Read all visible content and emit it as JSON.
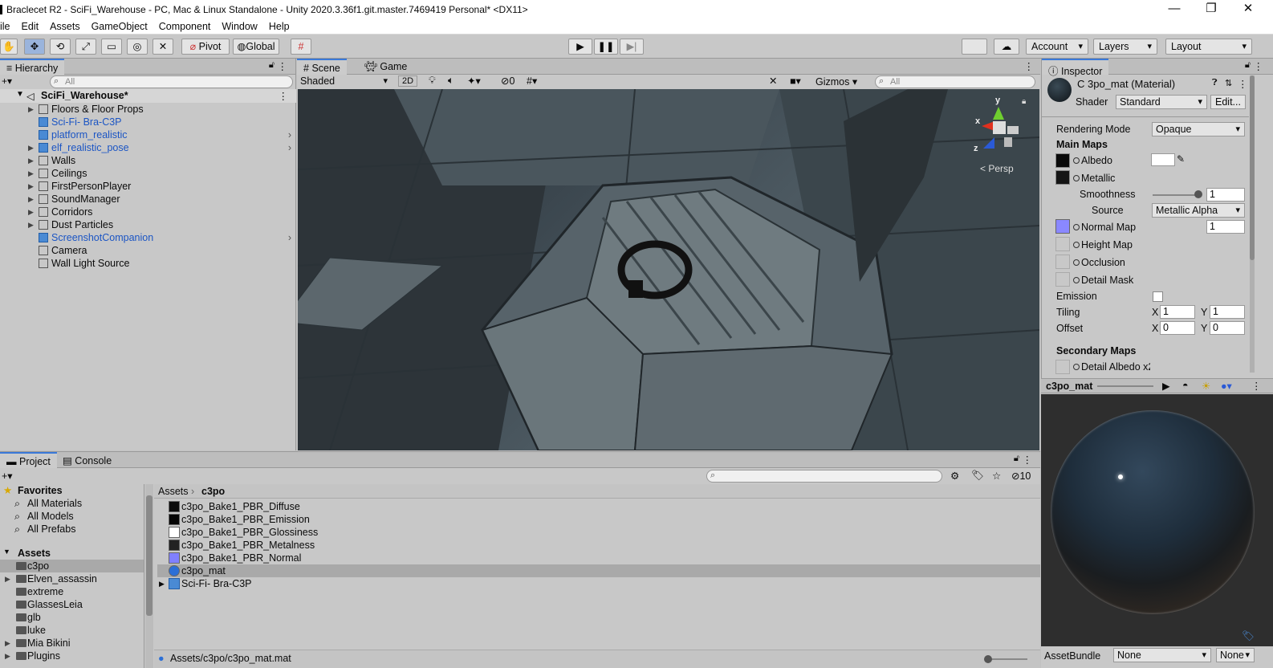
{
  "window": {
    "title": "Braclecet R2 - SciFi_Warehouse - PC, Mac & Linux Standalone - Unity 2020.3.36f1.git.master.7469419 Personal* <DX11>"
  },
  "menu": [
    "ile",
    "Edit",
    "Assets",
    "GameObject",
    "Component",
    "Window",
    "Help"
  ],
  "toolbar": {
    "pivot": "Pivot",
    "global": "Global",
    "account": "Account",
    "layers": "Layers",
    "layout": "Layout"
  },
  "hierarchy": {
    "tab": "Hierarchy",
    "search_placeholder": "All",
    "scene_name": "SciFi_Warehouse*",
    "items": [
      {
        "label": "Floors & Floor Props",
        "prefab": false,
        "expand": true
      },
      {
        "label": "Sci-Fi- Bra-C3P",
        "prefab": true,
        "expand": false
      },
      {
        "label": "platform_realistic",
        "prefab": true,
        "expand": false
      },
      {
        "label": "elf_realistic_pose",
        "prefab": true,
        "expand": true
      },
      {
        "label": "Walls",
        "prefab": false,
        "expand": true
      },
      {
        "label": "Ceilings",
        "prefab": false,
        "expand": true
      },
      {
        "label": "FirstPersonPlayer",
        "prefab": false,
        "expand": true
      },
      {
        "label": "SoundManager",
        "prefab": false,
        "expand": true
      },
      {
        "label": "Corridors",
        "prefab": false,
        "expand": true
      },
      {
        "label": "Dust Particles",
        "prefab": false,
        "expand": true
      },
      {
        "label": "ScreenshotCompanion",
        "prefab": true,
        "expand": false
      },
      {
        "label": "Camera",
        "prefab": false,
        "expand": false
      },
      {
        "label": "Wall Light Source",
        "prefab": false,
        "expand": false
      }
    ]
  },
  "scene": {
    "tab_scene": "Scene",
    "tab_game": "Game",
    "shading": "Shaded",
    "mode2d": "2D",
    "hidden_count": "0",
    "gizmos": "Gizmos",
    "search_placeholder": "All",
    "persp": "Persp",
    "axis_x": "x",
    "axis_y": "y",
    "axis_z": "z"
  },
  "inspector": {
    "tab": "Inspector",
    "material_title": "C 3po_mat (Material)",
    "shader_label": "Shader",
    "shader_value": "Standard",
    "edit": "Edit...",
    "rendering_mode_label": "Rendering Mode",
    "rendering_mode": "Opaque",
    "main_maps": "Main Maps",
    "albedo": "Albedo",
    "metallic": "Metallic",
    "smoothness": "Smoothness",
    "smoothness_value": "1",
    "source": "Source",
    "source_value": "Metallic Alpha",
    "normal_map": "Normal Map",
    "normal_value": "1",
    "height_map": "Height Map",
    "occlusion": "Occlusion",
    "detail_mask": "Detail Mask",
    "emission": "Emission",
    "tiling": "Tiling",
    "offset": "Offset",
    "x": "X",
    "y": "Y",
    "tiling_x": "1",
    "tiling_y": "1",
    "offset_x": "0",
    "offset_y": "0",
    "secondary_maps": "Secondary Maps",
    "detail_albedo": "Detail Albedo x2",
    "preview_name": "c3po_mat",
    "assetbundle_label": "AssetBundle",
    "assetbundle_value": "None",
    "assetbundle_variant": "None"
  },
  "project": {
    "tab_project": "Project",
    "tab_console": "Console",
    "favorites": "Favorites",
    "fav_items": [
      "All Materials",
      "All Models",
      "All Prefabs"
    ],
    "assets": "Assets",
    "folders": [
      {
        "label": "c3po",
        "expand": false
      },
      {
        "label": "Elven_assassin",
        "expand": true
      },
      {
        "label": "extreme",
        "expand": false
      },
      {
        "label": "GlassesLeia",
        "expand": false
      },
      {
        "label": "glb",
        "expand": false
      },
      {
        "label": "luke",
        "expand": false
      },
      {
        "label": "Mia Bikini",
        "expand": true
      },
      {
        "label": "Plugins",
        "expand": true
      }
    ],
    "breadcrumb": [
      "Assets",
      "c3po"
    ],
    "hidden_count": "10",
    "files": [
      {
        "label": "c3po_Bake1_PBR_Diffuse",
        "color": "#0a0a0a"
      },
      {
        "label": "c3po_Bake1_PBR_Emission",
        "color": "#050505"
      },
      {
        "label": "c3po_Bake1_PBR_Glossiness",
        "color": "#ffffff"
      },
      {
        "label": "c3po_Bake1_PBR_Metalness",
        "color": "#222222"
      },
      {
        "label": "c3po_Bake1_PBR_Normal",
        "color": "#8080ff"
      },
      {
        "label": "c3po_mat",
        "color": "#2c6fd6"
      },
      {
        "label": "Sci-Fi- Bra-C3P",
        "color": "#4a8ad4"
      }
    ],
    "status_path": "Assets/c3po/c3po_mat.mat"
  },
  "colors": {
    "selection": "#a9a9a9",
    "prefab_text": "#1b55c4",
    "accent": "#3a79d9"
  }
}
